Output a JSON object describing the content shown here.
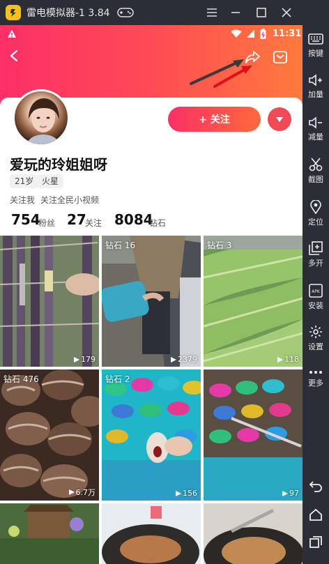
{
  "emulator": {
    "title": "雷电模拟器-1 3.84",
    "sidebar": [
      "按键",
      "加量",
      "减量",
      "截图",
      "定位",
      "多开",
      "安装",
      "设置",
      "更多"
    ]
  },
  "status": {
    "time": "11:31"
  },
  "profile": {
    "follow_label": "+ 关注",
    "name": "爱玩的玲姐姐呀",
    "tags": [
      "21岁",
      "火星"
    ],
    "links": [
      "关注我",
      "关注全民小视频"
    ],
    "stats": [
      {
        "value": "754",
        "label": "粉丝"
      },
      {
        "value": "27",
        "label": "关注"
      },
      {
        "value": "8084",
        "label": "钻石"
      }
    ]
  },
  "videos": [
    {
      "badge": "",
      "plays": "179",
      "scene": "sugarcane"
    },
    {
      "badge": "钻石 16",
      "plays": "2379",
      "scene": "man-bucket"
    },
    {
      "badge": "钻石 3",
      "plays": "118",
      "scene": "greens"
    },
    {
      "badge": "钻石 476",
      "plays": "6.7万",
      "scene": "seeds"
    },
    {
      "badge": "钻石 2",
      "plays": "156",
      "scene": "shells-toy"
    },
    {
      "badge": "",
      "plays": "97",
      "scene": "shells"
    },
    {
      "badge": "",
      "plays": "",
      "scene": "garden"
    },
    {
      "badge": "",
      "plays": "",
      "scene": "wok"
    },
    {
      "badge": "",
      "plays": "",
      "scene": "wok2"
    }
  ],
  "colors": {
    "accent": "#fc2f66",
    "accent2": "#ff7a3c"
  }
}
